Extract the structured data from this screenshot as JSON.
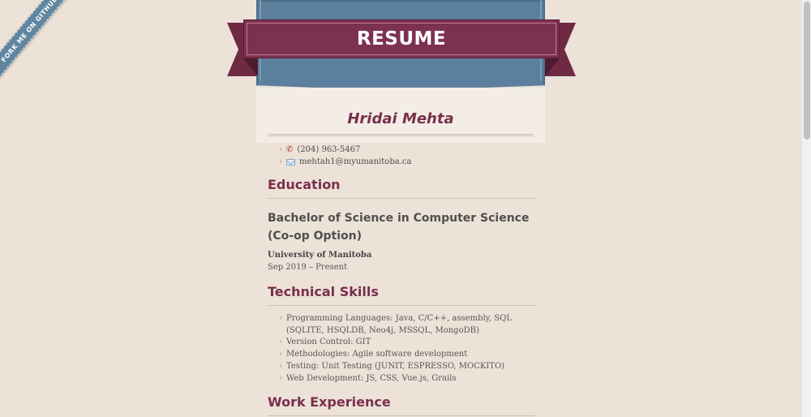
{
  "fork_ribbon": {
    "label": "FORK ME ON GITHUB"
  },
  "header": {
    "title": "RESUME",
    "name": "Hridai Mehta"
  },
  "contact": {
    "phone": "(204) 963-5467",
    "email": "mehtah1@myumanitoba.ca",
    "phone_icon": "phone-icon",
    "email_icon": "envelope-icon"
  },
  "education": {
    "heading": "Education",
    "degree": "Bachelor of Science in Computer Science (Co-op Option)",
    "school": "University of Manitoba",
    "dates": "Sep 2019 – Present"
  },
  "skills": {
    "heading": "Technical Skills",
    "items": [
      "Programming Languages: Java, C/C++, assembly, SQL (SQLITE, HSQLDB, Neo4j, MSSQL, MongoDB)",
      "Version Control: GIT",
      "Methodologies: Agile software development",
      "Testing: Unit Testing (JUNIT, ESPRESSO, MOCKITO)",
      "Web Development: JS, CSS, Vue.js, Grails"
    ]
  },
  "work": {
    "heading": "Work Experience"
  },
  "colors": {
    "background": "#ece2d8",
    "accent": "#7a2f4c",
    "header_blue": "#5b7f9c",
    "bullet": "#d08a5a"
  }
}
